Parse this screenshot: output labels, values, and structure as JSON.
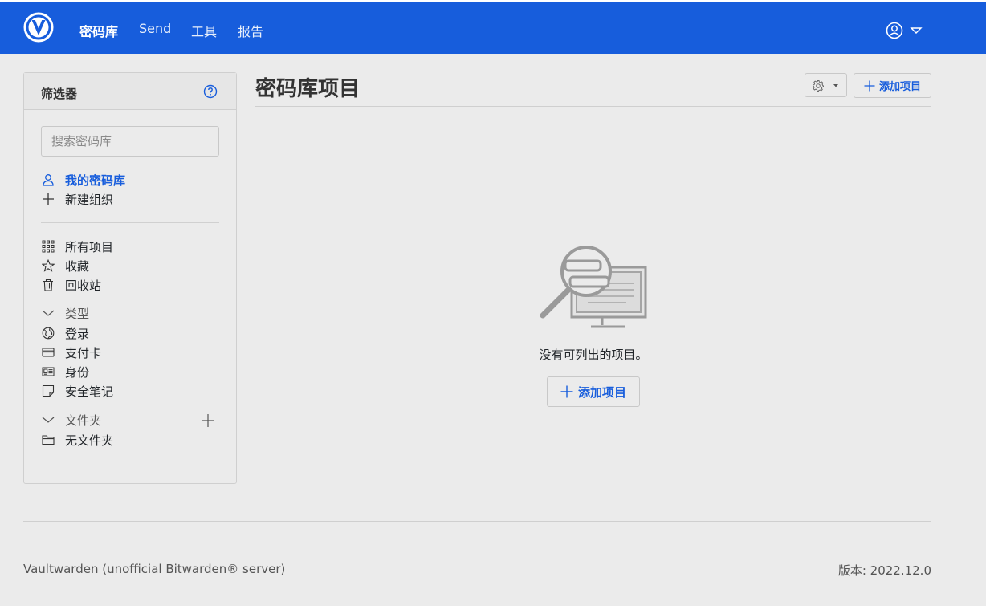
{
  "colors": {
    "brand": "#175ddc",
    "background": "#ebebeb"
  },
  "nav": {
    "logo_icon": "vaultwarden-shield-logo",
    "links": [
      {
        "label": "密码库",
        "active": true
      },
      {
        "label": "Send",
        "active": false
      },
      {
        "label": "工具",
        "active": false
      },
      {
        "label": "报告",
        "active": false
      }
    ],
    "account_icon": "user-circle-icon"
  },
  "filter": {
    "title": "筛选器",
    "search_placeholder": "搜索密码库",
    "vaults": [
      {
        "label": "我的密码库",
        "icon": "user-icon",
        "active": true
      },
      {
        "label": "新建组织",
        "icon": "plus-icon",
        "active": false
      }
    ],
    "items": [
      {
        "label": "所有项目",
        "icon": "grid-icon"
      },
      {
        "label": "收藏",
        "icon": "star-icon"
      },
      {
        "label": "回收站",
        "icon": "trash-icon"
      }
    ],
    "types_header": "类型",
    "types": [
      {
        "label": "登录",
        "icon": "globe-icon"
      },
      {
        "label": "支付卡",
        "icon": "credit-card-icon"
      },
      {
        "label": "身份",
        "icon": "id-card-icon"
      },
      {
        "label": "安全笔记",
        "icon": "sticky-note-icon"
      }
    ],
    "folders_header": "文件夹",
    "folders": [
      {
        "label": "无文件夹",
        "icon": "folder-icon"
      }
    ]
  },
  "main": {
    "title": "密码库项目",
    "add_item_label": "添加项目",
    "empty_text": "没有可列出的项目。",
    "empty_add_label": "添加项目"
  },
  "footer": {
    "left": "Vaultwarden (unofficial Bitwarden® server)",
    "right": "版本: 2022.12.0"
  }
}
